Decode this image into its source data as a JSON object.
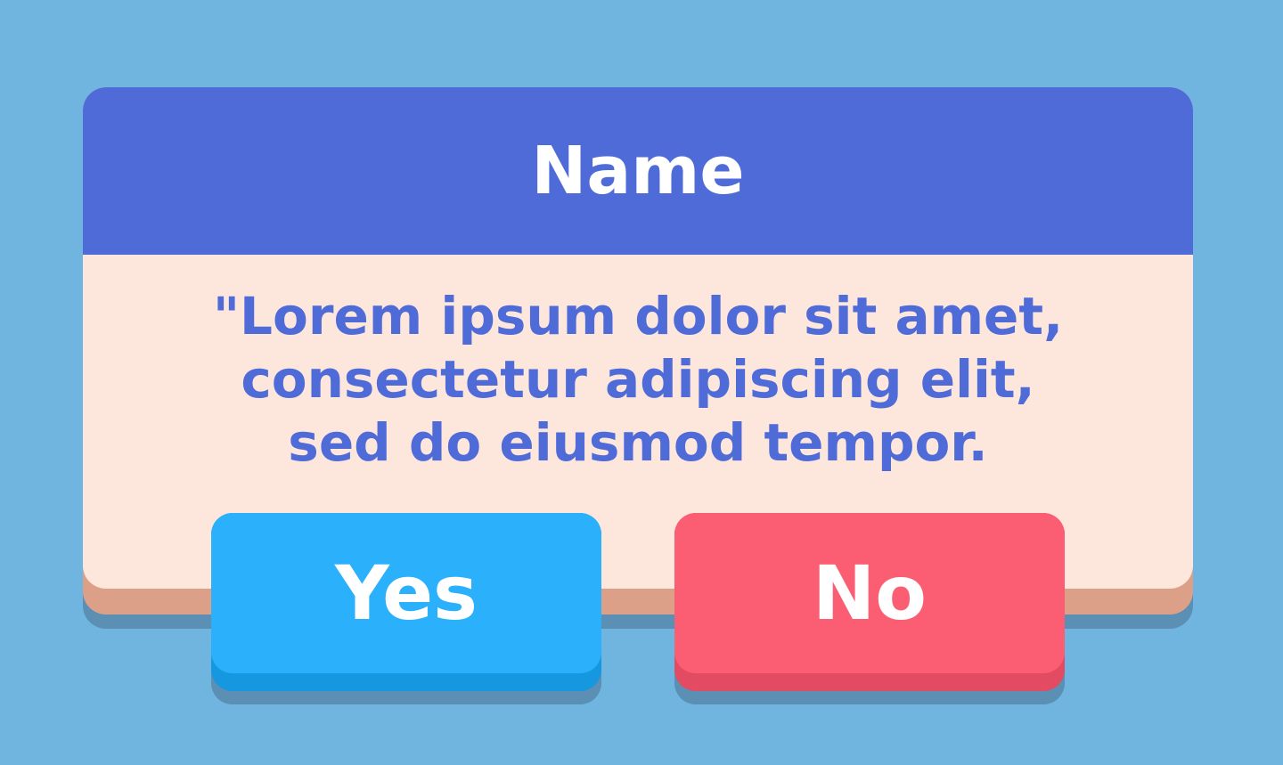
{
  "dialog": {
    "title": "Name",
    "message_lines": [
      "\"Lorem ipsum dolor sit amet,",
      "consectetur adipiscing elit,",
      "sed do eiusmod tempor."
    ]
  },
  "buttons": {
    "yes_label": "Yes",
    "no_label": "No"
  },
  "colors": {
    "background": "#6fb5e0",
    "header": "#4f6bd8",
    "panel": "#fde6dc",
    "panel_edge": "#dca089",
    "yes": "#2bb1fb",
    "no": "#fb5e73",
    "text_accent": "#4f6bd8"
  }
}
